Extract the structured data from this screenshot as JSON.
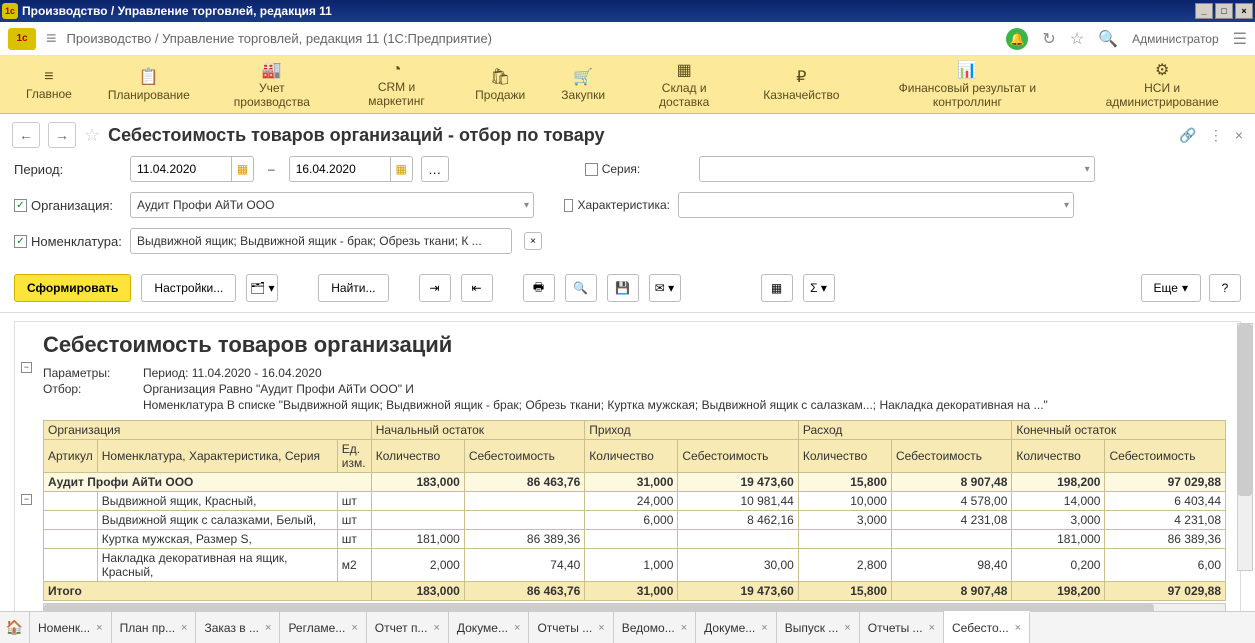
{
  "titlebar": {
    "text": "Производство / Управление торговлей, редакция 11"
  },
  "appheader": {
    "title": "Производство / Управление торговлей, редакция 11  (1С:Предприятие)",
    "user": "Администратор"
  },
  "mainmenu": [
    {
      "icon": "≡",
      "label": "Главное"
    },
    {
      "icon": "📋",
      "label": "Планирование"
    },
    {
      "icon": "🏭",
      "label": "Учет производства"
    },
    {
      "icon": "◔",
      "label": "CRM и маркетинг"
    },
    {
      "icon": "🛍",
      "label": "Продажи"
    },
    {
      "icon": "🛒",
      "label": "Закупки"
    },
    {
      "icon": "▦",
      "label": "Склад и доставка"
    },
    {
      "icon": "₽",
      "label": "Казначейство"
    },
    {
      "icon": "📊",
      "label": "Финансовый результат и\nконтроллинг"
    },
    {
      "icon": "⚙",
      "label": "НСИ и\nадминистрирование"
    }
  ],
  "page": {
    "title": "Себестоимость товаров организаций - отбор по товару"
  },
  "filters": {
    "period_label": "Период:",
    "date_from": "11.04.2020",
    "date_to": "16.04.2020",
    "org_label": "Организация:",
    "org_value": "Аудит Профи АйТи ООО",
    "nom_label": "Номенклатура:",
    "nom_value": "Выдвижной ящик; Выдвижной ящик - брак; Обрезь ткани; К ...",
    "series_label": "Серия:",
    "series_value": "",
    "char_label": "Характеристика:",
    "char_value": ""
  },
  "toolbar": {
    "form": "Сформировать",
    "settings": "Настройки...",
    "find": "Найти...",
    "more": "Еще"
  },
  "report": {
    "title": "Себестоимость товаров организаций",
    "params_label": "Параметры:",
    "params_value": "Период: 11.04.2020 - 16.04.2020",
    "filter_label": "Отбор:",
    "filter_line1": "Организация Равно \"Аудит Профи АйТи ООО\" И",
    "filter_line2": "Номенклатура В списке \"Выдвижной ящик; Выдвижной ящик - брак; Обрезь ткани; Куртка мужская; Выдвижной ящик с салазкам...; Накладка декоративная на ...\"",
    "headers": {
      "org": "Организация",
      "start": "Начальный остаток",
      "in": "Приход",
      "out": "Расход",
      "end": "Конечный остаток",
      "article": "Артикул",
      "nom": "Номенклатура, Характеристика, Серия",
      "unit": "Ед. изм.",
      "qty": "Количество",
      "cost": "Себестоимость"
    },
    "org_row": {
      "name": "Аудит Профи АйТи ООО",
      "start_qty": "183,000",
      "start_cost": "86 463,76",
      "in_qty": "31,000",
      "in_cost": "19 473,60",
      "out_qty": "15,800",
      "out_cost": "8 907,48",
      "end_qty": "198,200",
      "end_cost": "97 029,88"
    },
    "rows": [
      {
        "nom": "Выдвижной ящик, Красный,",
        "unit": "шт",
        "start_qty": "",
        "start_cost": "",
        "in_qty": "24,000",
        "in_cost": "10 981,44",
        "out_qty": "10,000",
        "out_cost": "4 578,00",
        "end_qty": "14,000",
        "end_cost": "6 403,44"
      },
      {
        "nom": "Выдвижной ящик с салазками, Белый,",
        "unit": "шт",
        "start_qty": "",
        "start_cost": "",
        "in_qty": "6,000",
        "in_cost": "8 462,16",
        "out_qty": "3,000",
        "out_cost": "4 231,08",
        "end_qty": "3,000",
        "end_cost": "4 231,08"
      },
      {
        "nom": "Куртка мужская, Размер S,",
        "unit": "шт",
        "start_qty": "181,000",
        "start_cost": "86 389,36",
        "in_qty": "",
        "in_cost": "",
        "out_qty": "",
        "out_cost": "",
        "end_qty": "181,000",
        "end_cost": "86 389,36"
      },
      {
        "nom": "Накладка декоративная на ящик, Красный,",
        "unit": "м2",
        "start_qty": "2,000",
        "start_cost": "74,40",
        "in_qty": "1,000",
        "in_cost": "30,00",
        "out_qty": "2,800",
        "out_cost": "98,40",
        "end_qty": "0,200",
        "end_cost": "6,00"
      }
    ],
    "total": {
      "label": "Итого",
      "start_qty": "183,000",
      "start_cost": "86 463,76",
      "in_qty": "31,000",
      "in_cost": "19 473,60",
      "out_qty": "15,800",
      "out_cost": "8 907,48",
      "end_qty": "198,200",
      "end_cost": "97 029,88"
    }
  },
  "tabs": [
    {
      "label": "Номенк...",
      "active": false
    },
    {
      "label": "План пр...",
      "active": false
    },
    {
      "label": "Заказ в ...",
      "active": false
    },
    {
      "label": "Регламе...",
      "active": false
    },
    {
      "label": "Отчет п...",
      "active": false
    },
    {
      "label": "Докуме...",
      "active": false
    },
    {
      "label": "Отчеты ...",
      "active": false
    },
    {
      "label": "Ведомо...",
      "active": false
    },
    {
      "label": "Докуме...",
      "active": false
    },
    {
      "label": "Выпуск ...",
      "active": false
    },
    {
      "label": "Отчеты ...",
      "active": false
    },
    {
      "label": "Себесто...",
      "active": true
    }
  ]
}
